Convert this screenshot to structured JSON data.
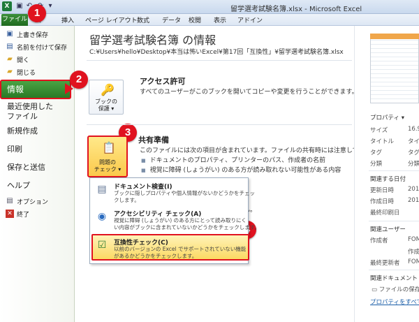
{
  "window": {
    "title": "留学選考試験名簿.xlsx - Microsoft Excel",
    "app_letter": "X"
  },
  "qat": [
    "save-icon",
    "undo-icon",
    "redo-icon",
    "dropdown-icon"
  ],
  "ribbon_tabs": {
    "file": "ファイル",
    "home": "ム",
    "insert": "挿入",
    "page_layout": "ページ レイアウト",
    "formulas": "数式",
    "data": "データ",
    "review": "校閲",
    "view": "表示",
    "addins": "アドイン"
  },
  "nav": {
    "save": "上書き保存",
    "save_as": "名前を付けて保存",
    "open": "開く",
    "close": "閉じる",
    "info": "情報",
    "recent_1": "最近使用した",
    "recent_2": "ファイル",
    "new": "新規作成",
    "print": "印刷",
    "save_send": "保存と送信",
    "help": "ヘルプ",
    "options": "オプション",
    "exit": "終了"
  },
  "badges": {
    "b1": "1",
    "b2": "2",
    "b3": "3",
    "b4": "4"
  },
  "main": {
    "title": "留学選考試験名簿 の情報",
    "path": "C:¥Users¥hello¥Desktop¥本当は怖いExcel¥第17回「互換性」¥留学選考試験名簿.xlsx",
    "permissions": {
      "button_line1": "ブックの",
      "button_line2": "保護",
      "heading": "アクセス許可",
      "desc": "すべてのユーザーがこのブックを開いてコピーや変更を行うことができます。"
    },
    "prepare": {
      "button_line1": "問題の",
      "button_line2": "チェック",
      "heading": "共有準備",
      "desc": "このファイルには次の項目が含まれています。ファイルの共有時には注意してください。",
      "bullets": [
        "ドキュメントのプロパティ、プリンターのパス、作成者の名前",
        "視覚に障碍 (しょうがい) のある方が読み取れない可能性がある内容"
      ]
    },
    "partial": "せん。"
  },
  "menu": {
    "items": [
      {
        "title": "ドキュメント検査(I)",
        "desc1": "ブックに隠しプロパティや個人情報がないかどうかをチェッ",
        "desc2": "クします。"
      },
      {
        "title": "アクセシビリティ チェック(A)",
        "desc1": "視覚に障碍 (しょうがい) のある方にとって読み取りにく",
        "desc2": "い内容がブックに含まれていないかどうかをチェックします。"
      },
      {
        "title": "互換性チェック(C)",
        "desc1": "以前のバージョンの Excel でサポートされていない機能",
        "desc2": "があるかどうかをチェックします。"
      }
    ]
  },
  "properties": {
    "header": "プロパティ ▾",
    "rows": [
      {
        "label": "サイズ",
        "value": "16.9"
      },
      {
        "label": "タイトル",
        "value": "タイト"
      },
      {
        "label": "タグ",
        "value": "タグの"
      },
      {
        "label": "分類",
        "value": "分類"
      }
    ],
    "dates_header": "関連する日付",
    "dates": [
      {
        "label": "更新日時",
        "value": "201"
      },
      {
        "label": "作成日時",
        "value": "201"
      },
      {
        "label": "最終印刷日",
        "value": ""
      }
    ],
    "users_header": "関連ユーザー",
    "users": [
      {
        "label": "作成者",
        "value": "FOM"
      },
      {
        "label": "",
        "value": "作成"
      },
      {
        "label": "最終更新者",
        "value": "FOM"
      }
    ],
    "docs_header": "関連ドキュメント",
    "docs_item": "ファイルの保存場",
    "show_all": "プロパティをすべて表示"
  }
}
